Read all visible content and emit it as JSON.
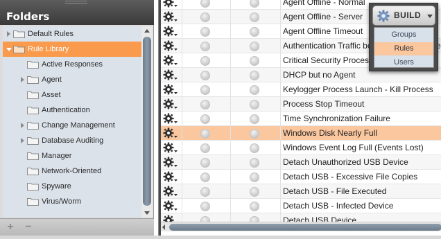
{
  "folders": {
    "title": "Folders",
    "items": [
      {
        "label": "Default Rules",
        "level": 0,
        "arrow": "closed"
      },
      {
        "label": "Rule Library",
        "level": 0,
        "arrow": "open",
        "selected": true
      },
      {
        "label": "Active Responses",
        "level": 1,
        "arrow": "none"
      },
      {
        "label": "Agent",
        "level": 1,
        "arrow": "closed"
      },
      {
        "label": "Asset",
        "level": 1,
        "arrow": "none"
      },
      {
        "label": "Authentication",
        "level": 1,
        "arrow": "none"
      },
      {
        "label": "Change Management",
        "level": 1,
        "arrow": "closed"
      },
      {
        "label": "Database Auditing",
        "level": 1,
        "arrow": "closed"
      },
      {
        "label": "Manager",
        "level": 1,
        "arrow": "none"
      },
      {
        "label": "Network-Oriented",
        "level": 1,
        "arrow": "none"
      },
      {
        "label": "Spyware",
        "level": 1,
        "arrow": "none"
      },
      {
        "label": "Virus/Worm",
        "level": 1,
        "arrow": "none"
      }
    ],
    "footer": {
      "add": "+",
      "remove": "−"
    }
  },
  "rules": {
    "rows": [
      {
        "name": "Agent Offline - Normal"
      },
      {
        "name": "Agent Offline - Server"
      },
      {
        "name": "Agent Offline Timeout"
      },
      {
        "name": "Authentication Traffic between Different Networks"
      },
      {
        "name": "Critical Security Process Stopped"
      },
      {
        "name": "DHCP but no Agent"
      },
      {
        "name": "Keylogger Process Launch - Kill Process"
      },
      {
        "name": "Process Stop Timeout"
      },
      {
        "name": "Time Synchronization Failure"
      },
      {
        "name": "Windows Disk Nearly Full",
        "selected": true
      },
      {
        "name": "Windows Event Log Full (Events Lost)"
      },
      {
        "name": "Detach Unauthorized USB Device"
      },
      {
        "name": "Detach USB - Excessive File Copies"
      },
      {
        "name": "Detach USB - File Executed"
      },
      {
        "name": "Detach USB - Infected Device"
      },
      {
        "name": "Detach USB Device"
      }
    ]
  },
  "build": {
    "label": "BUILD",
    "menu": [
      {
        "label": "Groups"
      },
      {
        "label": "Rules",
        "active": true
      },
      {
        "label": "Users"
      }
    ]
  },
  "colors": {
    "selection": "#f99a4c",
    "row_selection": "#fbc79f",
    "header_dark": "#3a3a3a"
  }
}
